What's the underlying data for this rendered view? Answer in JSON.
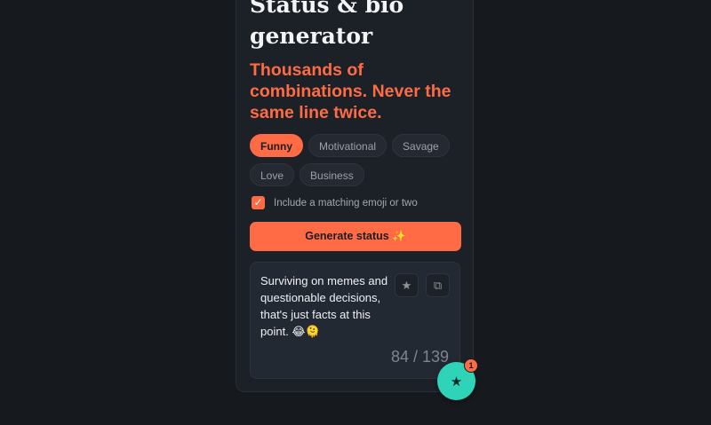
{
  "header": {
    "title": "Status & bio generator",
    "subtitle": "Thousands of combinations. Never the same line twice."
  },
  "categories": [
    {
      "label": "Funny",
      "active": true
    },
    {
      "label": "Motivational",
      "active": false
    },
    {
      "label": "Savage",
      "active": false
    },
    {
      "label": "Love",
      "active": false
    },
    {
      "label": "Business",
      "active": false
    }
  ],
  "emoji_option": {
    "label": "Include a matching emoji or two",
    "checked": true
  },
  "generate_button": {
    "label": "Generate status ✨"
  },
  "result": {
    "text": "Surviving on memes and questionable decisions, that's just facts at this point. 😂🫠",
    "favorite_icon": "star-icon",
    "copy_icon": "copy-icon",
    "favorite_glyph": "★",
    "copy_glyph": "⧉",
    "counter": "84 / 139"
  },
  "favorites_fab": {
    "icon": "star-icon",
    "glyph": "★",
    "badge_count": "1"
  },
  "colors": {
    "accent": "#ff6b45",
    "fab": "#2fd4b8",
    "background": "#16191e",
    "card": "#1c2027"
  }
}
